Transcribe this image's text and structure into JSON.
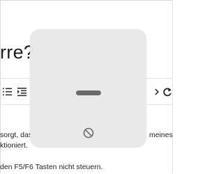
{
  "page": {
    "title_fragment": "rre?",
    "toolbar": {
      "numbered_list_icon": "numbered-list-icon",
      "indent_icon": "indent-icon",
      "redo_icon": "redo-icon"
    },
    "body_lines": [
      {
        "left": "sorgt, das",
        "right": "meines"
      },
      {
        "left": "ktioniert.",
        "right": ""
      },
      {
        "left": "den F5/F6 Tasten nicht steuern.",
        "right": ""
      }
    ]
  },
  "overlay": {
    "type": "brightness-indicator",
    "level": 0,
    "icons": {
      "bar": "minimum-level-bar",
      "status": "not-allowed-icon"
    }
  }
}
